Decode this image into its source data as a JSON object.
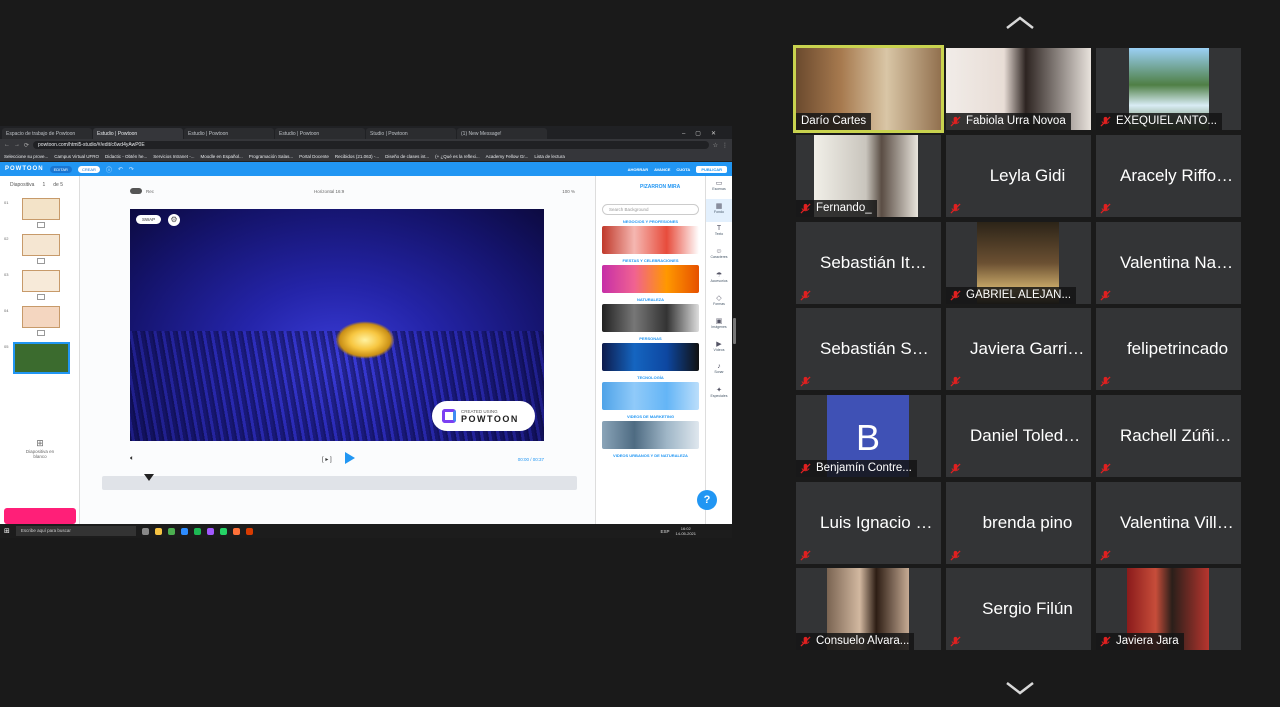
{
  "browser": {
    "tabs": [
      {
        "label": "Espacio de trabajo de Powtoon",
        "active": false
      },
      {
        "label": "Estudio | Powtoon",
        "active": true
      },
      {
        "label": "Estudio | Powtoon",
        "active": false
      },
      {
        "label": "Estudio | Powtoon",
        "active": false
      },
      {
        "label": "Studio | Powtoon",
        "active": false
      },
      {
        "label": "(1) New Message!",
        "active": false
      }
    ],
    "url": "powtoon.com/html5-studio/#/edit/c6wd4yAwP0E",
    "bookmarks": [
      "Seleccione su prove...",
      "Campus Virtual UFRO",
      "Didactic - Obtén he...",
      "Servicios Intranet -...",
      "Moodle en Español...",
      "Programación Salas...",
      "Portal Docente",
      "Recibidos (21.063) -...",
      "Diseño de clases int...",
      "(+ ¿Qué es la reflexi...",
      "Academy Fellow Gr...",
      "Lista de lectura"
    ]
  },
  "powtoon": {
    "logo": "POWTOON",
    "edit_label": "EDITAR",
    "create_label": "CREAR",
    "links": [
      "AHORRAR",
      "AVANCE",
      "CUOTA"
    ],
    "publish_label": "PUBLICAR",
    "slides_label": "Diapositiva",
    "slides_count": "1",
    "slides_of": "de 5",
    "slide_numbers": [
      "01",
      "02",
      "03",
      "04",
      "05"
    ],
    "add_slide_label": "Diapositiva en blanco",
    "rec_label": "Rec",
    "format_label": "Horizontal 16:9",
    "zoom_label": "100 %",
    "swap_label": "SWAP",
    "badge_small": "CREATED USING",
    "badge_big": "POWTOON",
    "play_mode": "[ ▸ ]",
    "time_label": "00:00 / 00:37",
    "user_name": "PIZARRON MIRA",
    "search_placeholder": "Search Background",
    "categories": [
      "NEGOCIOS Y PROFESIONES",
      "FIESTAS Y CELEBRACIONES",
      "NATURALEZA",
      "PERSONAS",
      "TECNOLOGÍA",
      "VIDEOS DE MARKETING",
      "VIDEOS URBANOS Y DE NATURALEZA"
    ],
    "rail": [
      {
        "label": "Escenas",
        "icon": "scenes-icon",
        "glyph": "▭"
      },
      {
        "label": "Fondo",
        "icon": "background-icon",
        "glyph": "▦"
      },
      {
        "label": "Texto",
        "icon": "text-icon",
        "glyph": "T"
      },
      {
        "label": "Caracteres",
        "icon": "characters-icon",
        "glyph": "☺"
      },
      {
        "label": "Accesorios",
        "icon": "props-icon",
        "glyph": "☂"
      },
      {
        "label": "Formas",
        "icon": "shapes-icon",
        "glyph": "◇"
      },
      {
        "label": "Imágenes",
        "icon": "images-icon",
        "glyph": "▣"
      },
      {
        "label": "Vídeos",
        "icon": "videos-icon",
        "glyph": "▶"
      },
      {
        "label": "Sonar",
        "icon": "music-icon",
        "glyph": "♪"
      },
      {
        "label": "Especiales",
        "icon": "specials-icon",
        "glyph": "✦"
      }
    ],
    "help_label": "?"
  },
  "taskbar": {
    "search_placeholder": "Escribe aquí para buscar",
    "language": "ESP",
    "time": "16:02",
    "date": "14-05-2021"
  },
  "participants": [
    {
      "name": "Darío Cartes",
      "muted": false,
      "active": true,
      "video": true
    },
    {
      "name": "Fabiola Urra Novoa",
      "muted": true,
      "active": false,
      "video": true
    },
    {
      "name": "EXEQUIEL ANTO...",
      "muted": true,
      "active": false,
      "video": true
    },
    {
      "name": "Fernando_",
      "muted": true,
      "active": false,
      "video": true
    },
    {
      "name": "Leyla Gidi",
      "muted": true,
      "active": false,
      "video": false
    },
    {
      "name": "Aracely Riffo V...",
      "muted": true,
      "active": false,
      "video": false
    },
    {
      "name": "Sebastián Iturr...",
      "muted": true,
      "active": false,
      "video": false
    },
    {
      "name": "GABRIEL ALEJAN...",
      "muted": true,
      "active": false,
      "video": true
    },
    {
      "name": "Valentina Nan...",
      "muted": true,
      "active": false,
      "video": false
    },
    {
      "name": "Sebastián Sep...",
      "muted": true,
      "active": false,
      "video": false
    },
    {
      "name": "Javiera Garrido",
      "muted": true,
      "active": false,
      "video": false
    },
    {
      "name": "felipetrincado",
      "muted": true,
      "active": false,
      "video": false
    },
    {
      "name": "Benjamín Contre...",
      "muted": true,
      "active": false,
      "video": true,
      "avatar": "B"
    },
    {
      "name": "Daniel Toledo...",
      "muted": true,
      "active": false,
      "video": false
    },
    {
      "name": "Rachell Zúñig...",
      "muted": true,
      "active": false,
      "video": false
    },
    {
      "name": "Luis Ignacio Z...",
      "muted": true,
      "active": false,
      "video": false
    },
    {
      "name": "brenda pino",
      "muted": true,
      "active": false,
      "video": false
    },
    {
      "name": "Valentina Ville...",
      "muted": true,
      "active": false,
      "video": false
    },
    {
      "name": "Consuelo Alvara...",
      "muted": true,
      "active": false,
      "video": true
    },
    {
      "name": "Sergio Filún",
      "muted": true,
      "active": false,
      "video": false
    },
    {
      "name": "Javiera Jara",
      "muted": true,
      "active": false,
      "video": true
    }
  ],
  "colors": {
    "accent": "#2196f3",
    "active_speaker": "#c9d34f",
    "muted": "#e02020",
    "pink": "#ff1f78"
  }
}
